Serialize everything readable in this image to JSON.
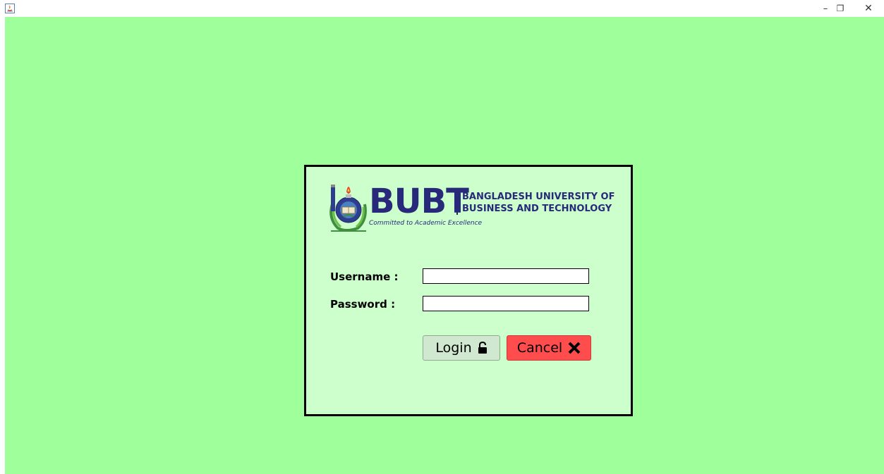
{
  "window": {
    "icon": "java-icon",
    "minimize_glyph": "–",
    "maximize_glyph": "❐",
    "close_glyph": "✕"
  },
  "colors": {
    "client_background": "#9eff9b",
    "panel_background": "#ccffcc",
    "brand_navy": "#28297a",
    "cancel_red": "#ff4c4c"
  },
  "logo": {
    "acronym": "BUBT",
    "name_line1": "BANGLADESH UNIVERSITY OF",
    "name_line2": "BUSINESS AND TECHNOLOGY",
    "tagline": "Committed to Academic Excellence"
  },
  "form": {
    "username_label": "Username :",
    "password_label": "Password  :",
    "username_value": "",
    "password_value": ""
  },
  "buttons": {
    "login_label": "Login",
    "login_icon": "unlock-icon",
    "cancel_label": "Cancel",
    "cancel_icon": "x-icon"
  }
}
